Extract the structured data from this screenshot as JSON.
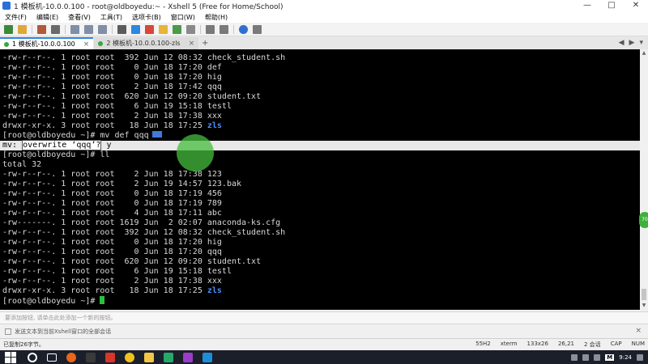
{
  "window": {
    "title": "1 模板机-10.0.0.100 - root@oldboyedu:~ - Xshell 5 (Free for Home/School)",
    "controls": [
      "—",
      "□",
      "✕"
    ]
  },
  "menu": [
    "文件(F)",
    "编辑(E)",
    "查看(V)",
    "工具(T)",
    "选项卡(B)",
    "窗口(W)",
    "帮助(H)"
  ],
  "tabs": [
    {
      "label": "1 模板机-10.0.0.100",
      "active": true,
      "dot_color": "#3aa53a"
    },
    {
      "label": "2 模板机-10.0.0.100-zls",
      "active": false,
      "dot_color": "#3aa53a"
    }
  ],
  "tab_add": "+",
  "tab_nav": [
    "◀",
    "▶",
    "▾"
  ],
  "terminal": {
    "lines": [
      {
        "text": "-rw-r--r--. 1 root root  392 Jun 12 08:32 check_student.sh"
      },
      {
        "text": "-rw-r--r--. 1 root root    0 Jun 18 17:20 def"
      },
      {
        "text": "-rw-r--r--. 1 root root    0 Jun 18 17:20 hig"
      },
      {
        "text": "-rw-r--r--. 1 root root    2 Jun 18 17:42 qqq"
      },
      {
        "text": "-rw-r--r--. 1 root root  620 Jun 12 09:20 student.txt"
      },
      {
        "text": "-rw-r--r--. 1 root root    6 Jun 19 15:18 testl"
      },
      {
        "text": "-rw-r--r--. 1 root root    2 Jun 18 17:38 xxx"
      },
      {
        "text": "drwxr-xr-x. 3 root root   18 Jun 18 17:25 ",
        "dir": "zls"
      },
      {
        "text": "[root@oldboyedu ~]# mv def qqq",
        "badge": true
      },
      {
        "pre": "mv: ",
        "sel": "overwrite ‘qqq’?",
        "text": " y",
        "highlight": true
      },
      {
        "text": "[root@oldboyedu ~]# ll"
      },
      {
        "text": "total 32"
      },
      {
        "text": "-rw-r--r--. 1 root root    2 Jun 18 17:38 123"
      },
      {
        "text": "-rw-r--r--. 1 root root    2 Jun 19 14:57 123.bak"
      },
      {
        "text": "-rw-r--r--. 1 root root    0 Jun 18 17:19 456"
      },
      {
        "text": "-rw-r--r--. 1 root root    0 Jun 18 17:19 789"
      },
      {
        "text": "-rw-r--r--. 1 root root    4 Jun 18 17:11 abc"
      },
      {
        "text": "-rw-------. 1 root root 1619 Jun  2 02:07 anaconda-ks.cfg"
      },
      {
        "text": "-rw-r--r--. 1 root root  392 Jun 12 08:32 check_student.sh"
      },
      {
        "text": "-rw-r--r--. 1 root root    0 Jun 18 17:20 hig"
      },
      {
        "text": "-rw-r--r--. 1 root root    0 Jun 18 17:20 qqq"
      },
      {
        "text": "-rw-r--r--. 1 root root  620 Jun 12 09:20 student.txt"
      },
      {
        "text": "-rw-r--r--. 1 root root    6 Jun 19 15:18 testl"
      },
      {
        "text": "-rw-r--r--. 1 root root    2 Jun 18 17:38 xxx"
      },
      {
        "text": "drwxr-xr-x. 3 root root   18 Jun 18 17:25 ",
        "dir": "zls"
      },
      {
        "text": "[root@oldboyedu ~]# ",
        "cursor": true
      }
    ]
  },
  "side_bubble": "70",
  "input_bar": {
    "placeholder": "要添加按钮, 请单击此处添加一个新的按钮。"
  },
  "compose_bar": {
    "text": "发送文本到当前Xshell窗口的全部会话",
    "close": "×"
  },
  "status_bar": {
    "left": "已复制26字节。",
    "right": [
      "55H2",
      "xterm",
      "133x26",
      "26,21",
      "2 会话",
      "CAP",
      "NUM"
    ]
  },
  "taskbar": {
    "clock": "9:24",
    "ime": "M",
    "icons": [
      {
        "name": "search-icon",
        "color": "#ffffff"
      },
      {
        "name": "task-view-icon",
        "color": "#ffffff"
      },
      {
        "name": "firefox-icon",
        "color": "#e8661e"
      },
      {
        "name": "terminal-icon",
        "color": "#3a3a3a"
      },
      {
        "name": "xshell-icon",
        "color": "#d8362a"
      },
      {
        "name": "chrome-icon",
        "color": "#f0c21f"
      },
      {
        "name": "explorer-icon",
        "color": "#f3c643"
      },
      {
        "name": "app-icon",
        "color": "#25a96b"
      },
      {
        "name": "media-icon",
        "color": "#9a3dc8"
      },
      {
        "name": "app2-icon",
        "color": "#1e8edb"
      }
    ]
  }
}
